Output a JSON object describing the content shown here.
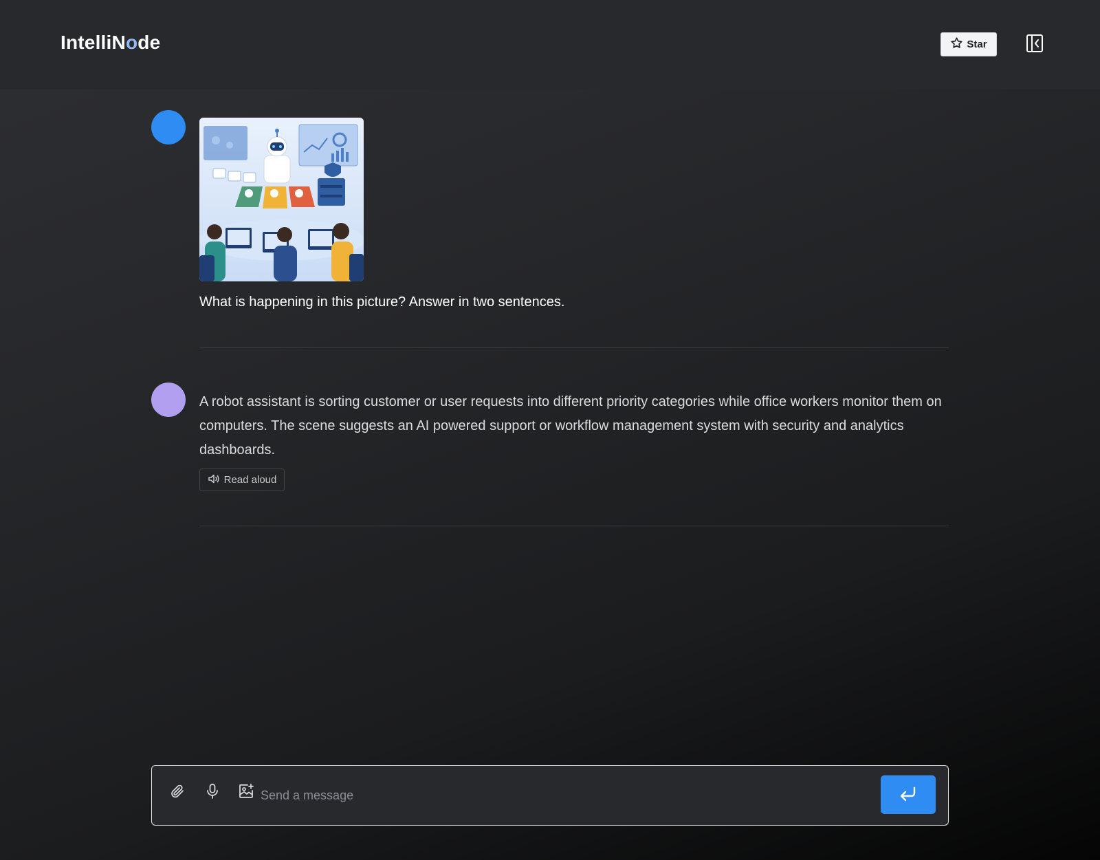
{
  "header": {
    "logo_prefix": "IntelliN",
    "logo_o": "o",
    "logo_suffix": "de",
    "star_label": "Star",
    "star_icon": "star-icon",
    "collapse_icon": "sidebar-collapse-icon"
  },
  "conversation": {
    "user_message": {
      "image_icon": "robot-office-illustration",
      "text": "What is happening in this picture? Answer in two sentences."
    },
    "assistant_message": {
      "text": "A robot assistant is sorting customer or user requests into different priority categories while office workers monitor them on computers. The scene suggests an AI powered support or workflow management system with security and analytics dashboards.",
      "read_aloud_label": "Read aloud",
      "read_aloud_icon": "speaker-icon"
    }
  },
  "composer": {
    "placeholder": "Send a message",
    "attach_icon": "paperclip-icon",
    "mic_icon": "microphone-icon",
    "image_icon": "image-add-icon",
    "send_icon": "enter-icon"
  },
  "colors": {
    "accent": "#2f8cf2",
    "user_avatar": "#2f8cf2",
    "assistant_avatar": "#b39ff0"
  }
}
